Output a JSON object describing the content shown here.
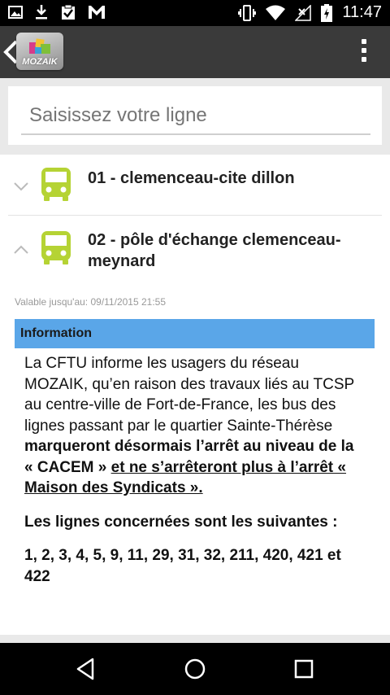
{
  "status_bar": {
    "time": "11:47",
    "left_icons": [
      "image-icon",
      "download-icon",
      "clipboard-check-icon",
      "gmail-icon"
    ],
    "right_icons": [
      "vibrate-icon",
      "wifi-icon",
      "no-signal-icon",
      "battery-charging-icon"
    ]
  },
  "app_bar": {
    "logo_text": "MOZAIK"
  },
  "search": {
    "placeholder": "Saisissez votre ligne"
  },
  "lines": [
    {
      "title": "01 - clemenceau-cite dillon",
      "expanded": false,
      "icon": "bus-icon",
      "icon_color": "#b5d334"
    },
    {
      "title": "02 - pôle d'échange clemenceau-meynard",
      "expanded": true,
      "icon": "bus-icon",
      "icon_color": "#b5d334"
    }
  ],
  "details": {
    "validity": "Valable jusqu'au: 09/11/2015 21:55",
    "info_header": "Information",
    "para1_normal": "La CFTU informe les usagers du réseau MOZAIK, qu’en raison des travaux liés au TCSP au centre-ville de Fort-de-France, les bus des lignes passant par le quartier Sainte-Thérèse ",
    "para1_bold": "marqueront désormais l’arrêt au niveau de la « CACEM » ",
    "para1_underline": "et ne s’arrêteront plus à l’arrêt « Maison des Syndicats ».",
    "para2": "Les lignes concernées sont les suivantes :",
    "para3": "1, 2, 3, 4, 5, 9, 11, 29, 31, 32, 211, 420, 421 et 422"
  },
  "colors": {
    "accent_blue": "#5aa6e8",
    "bus_green": "#b5d334",
    "app_bar": "#3a3a3a"
  }
}
